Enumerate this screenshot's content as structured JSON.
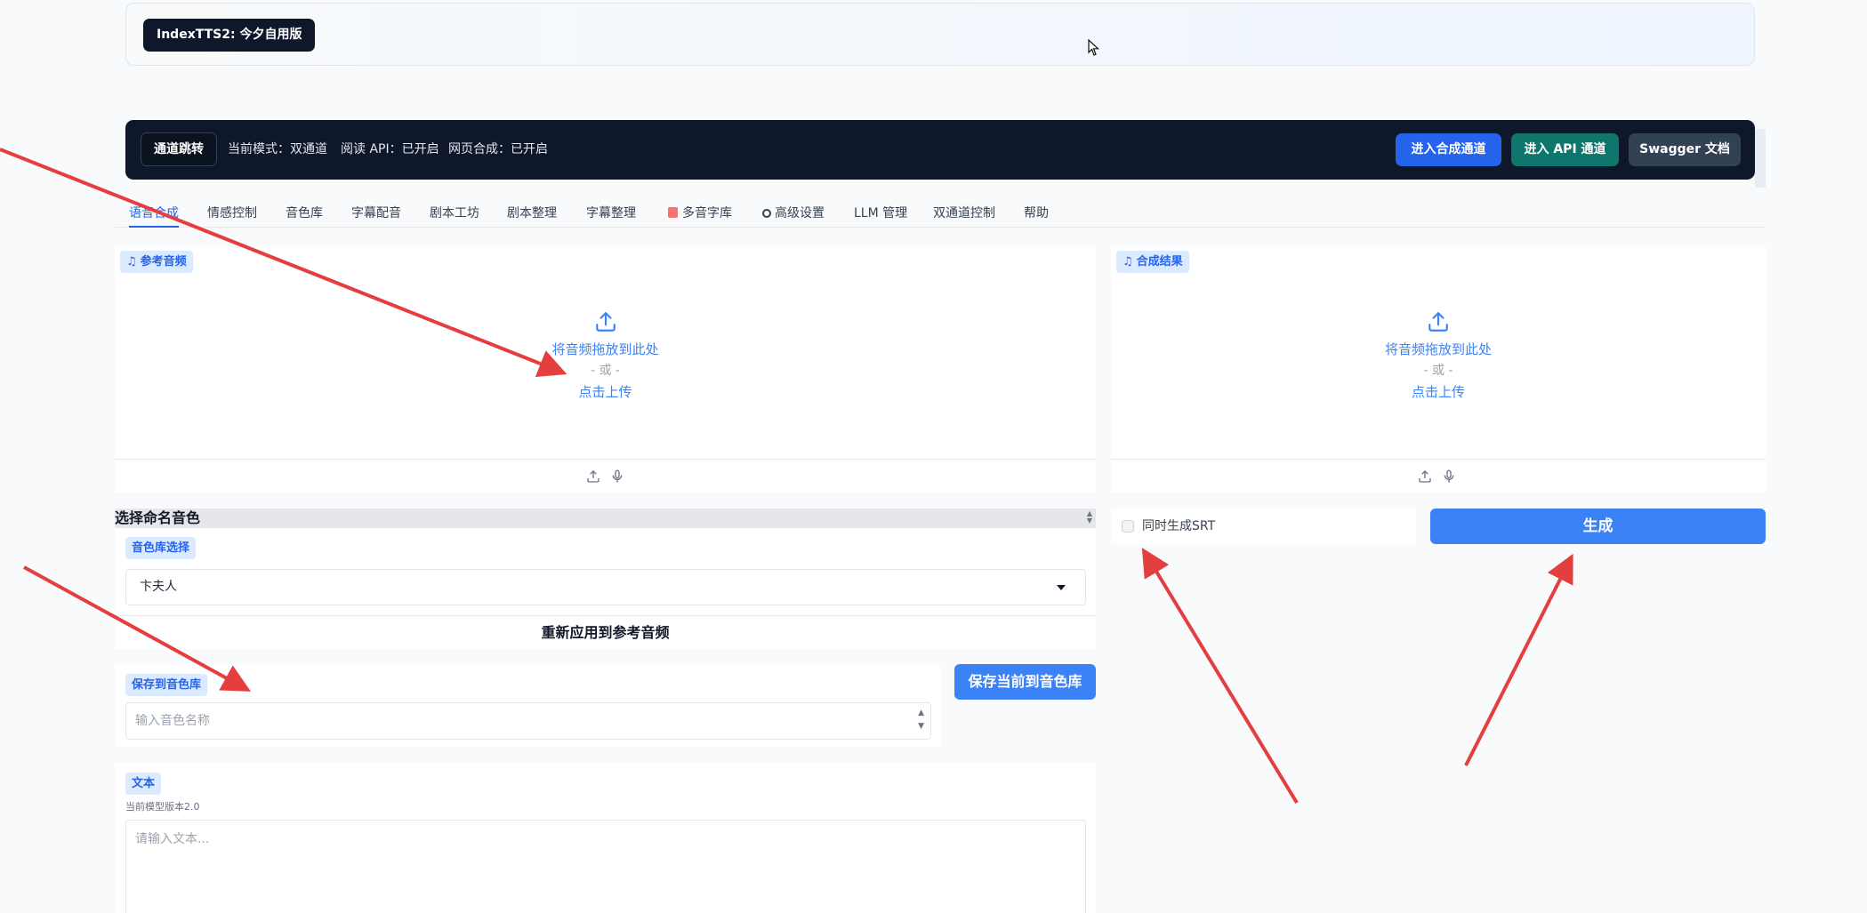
{
  "app": {
    "title_badge": "IndexTTS2: 今夕自用版"
  },
  "channel_bar": {
    "jump_label": "通道跳转",
    "mode_text": "当前模式：双通道",
    "read_api_text": "阅读 API：已开启",
    "web_synthesis_text": "网页合成：已开启",
    "enter_synthesis_label": "进入合成通道",
    "enter_api_label": "进入 API 通道",
    "swagger_label": "Swagger 文档",
    "colors": {
      "bar": "#0f172a",
      "synthesis_btn": "#2563eb",
      "api_btn": "#0f766e",
      "swagger_btn": "#334155"
    }
  },
  "tabs": [
    {
      "label": "语音合成",
      "active": true
    },
    {
      "label": "情感控制"
    },
    {
      "label": "音色库"
    },
    {
      "label": "字幕配音"
    },
    {
      "label": "剧本工坊"
    },
    {
      "label": "剧本整理"
    },
    {
      "label": "字幕整理"
    },
    {
      "label": "多音字库",
      "icon": "book-icon"
    },
    {
      "label": "高级设置",
      "icon": "gear-icon"
    },
    {
      "label": "LLM 管理"
    },
    {
      "label": "双通道控制"
    },
    {
      "label": "帮助"
    }
  ],
  "reference_audio": {
    "label": "参考音频",
    "drop_text": "将音频拖放到此处",
    "or_text": "- 或 -",
    "click_text": "点击上传"
  },
  "result_audio": {
    "label": "合成结果",
    "drop_text": "将音频拖放到此处",
    "or_text": "- 或 -",
    "click_text": "点击上传"
  },
  "voice_select": {
    "header": "选择命名音色",
    "library_label": "音色库选择",
    "selected_value": "卞夫人",
    "reapply_label": "重新应用到参考音频"
  },
  "save_voice": {
    "label": "保存到音色库",
    "placeholder": "输入音色名称",
    "button_label": "保存当前到音色库"
  },
  "text_input": {
    "label": "文本",
    "model_version": "当前模型版本2.0",
    "placeholder": "请输入文本..."
  },
  "srt": {
    "label": "同时生成SRT",
    "checked": false
  },
  "generate": {
    "label": "生成"
  },
  "annotation_color": "#e53e3e"
}
